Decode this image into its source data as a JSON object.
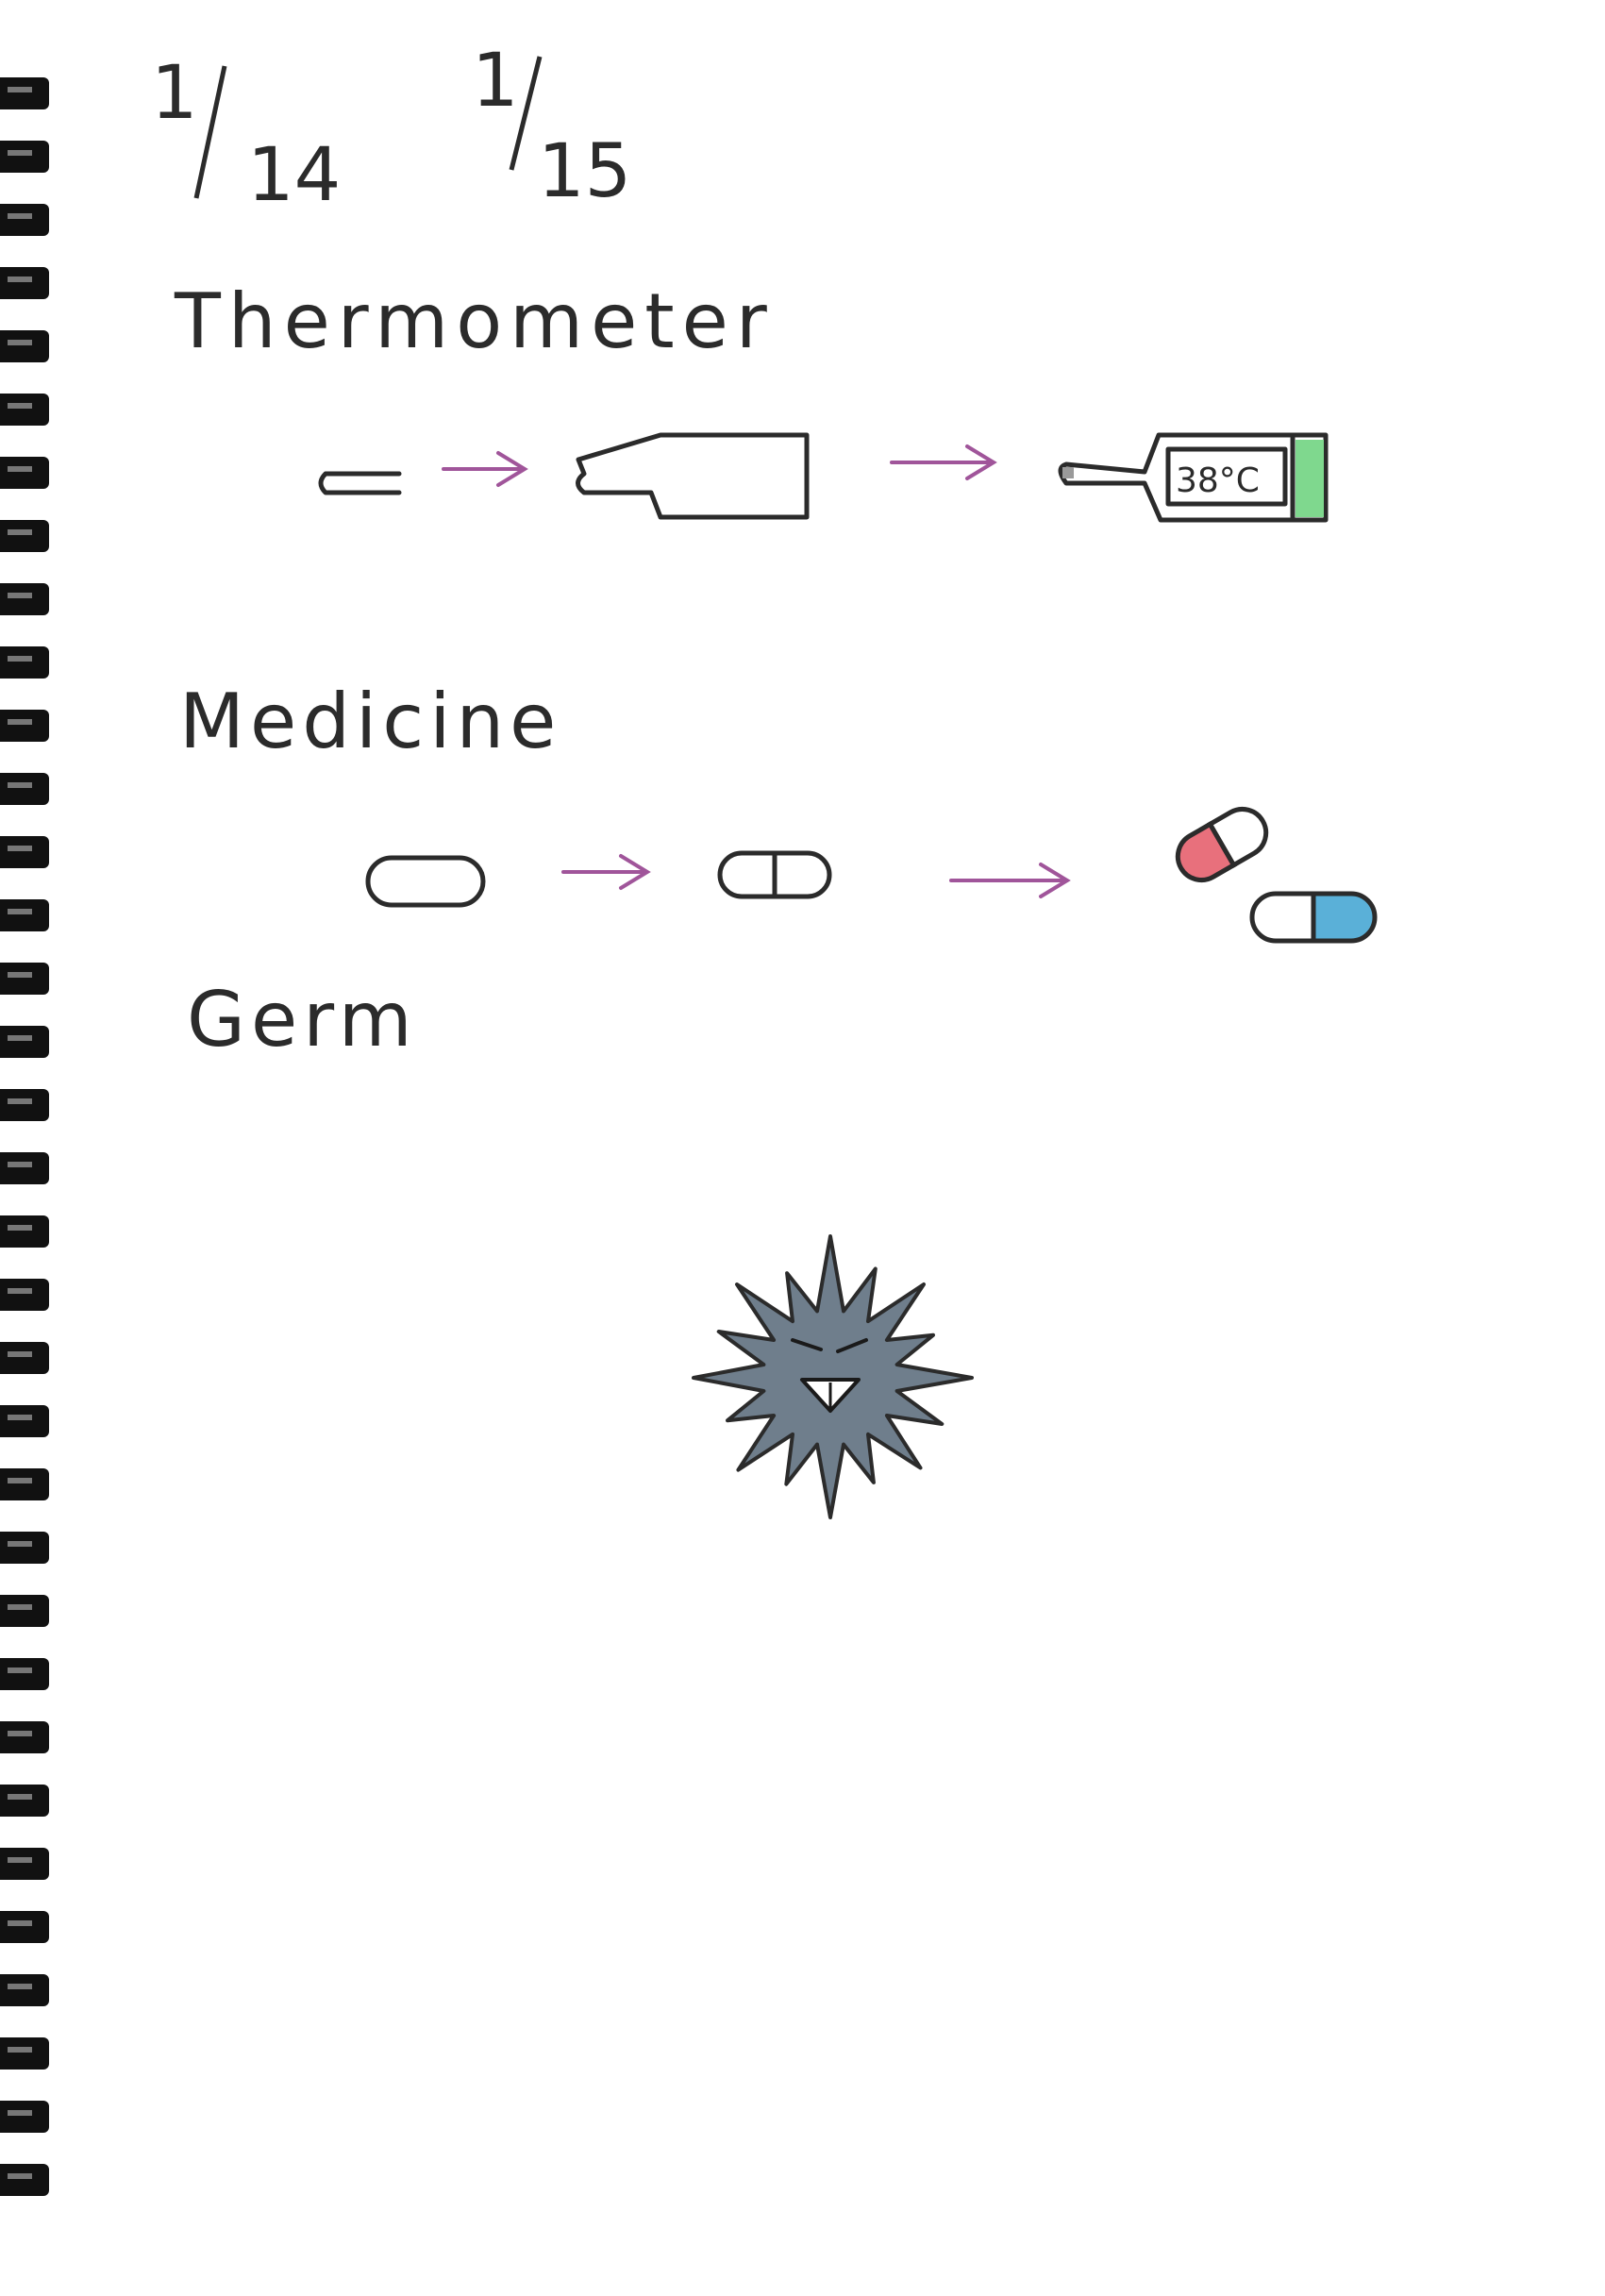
{
  "dates": {
    "first": {
      "num": "1",
      "den": "14"
    },
    "second": {
      "num": "1",
      "den": "15"
    }
  },
  "sections": {
    "thermometer": {
      "heading": "Thermometer",
      "display": "38°C"
    },
    "medicine": {
      "heading": "Medicine"
    },
    "germ": {
      "heading": "Germ"
    }
  },
  "colors": {
    "ink": "#2b2b2b",
    "arrow": "#a0559a",
    "thermometer_end": "#7fd88e",
    "capsule_red": "#e8707c",
    "capsule_blue": "#5ab0d8",
    "germ_body": "#6f7e8c",
    "spiral": "#111111"
  },
  "icons": [
    "spiral-binding-icon",
    "arrow-right-icon",
    "thermometer-icon",
    "capsule-icon",
    "germ-icon"
  ]
}
